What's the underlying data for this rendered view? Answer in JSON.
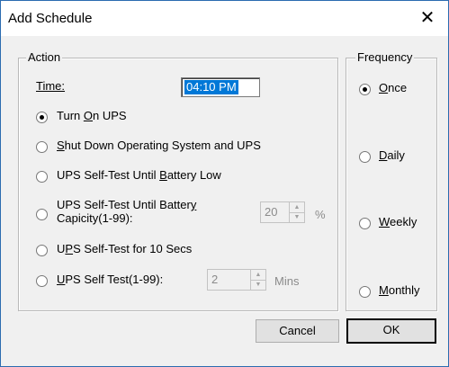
{
  "window": {
    "title": "Add Schedule",
    "close_glyph": "✕"
  },
  "action": {
    "legend": "Action",
    "time_label": "Time:",
    "time_value": "04:10 PM",
    "options": [
      {
        "pre": "Turn ",
        "mn": "O",
        "post": "n UPS",
        "checked": true
      },
      {
        "pre": "",
        "mn": "S",
        "post": "hut Down Operating System and UPS",
        "checked": false
      },
      {
        "pre": "UPS Self-Test Until ",
        "mn": "B",
        "post": "attery Low",
        "checked": false
      },
      {
        "line1_pre": "UPS Self-Test Until Batter",
        "line1_mn": "y",
        "line2": "Capicity(1-99):",
        "checked": false
      },
      {
        "pre": "U",
        "mn": "P",
        "post": "S Self-Test for 10 Secs",
        "checked": false
      },
      {
        "pre": "",
        "mn": "U",
        "post": "PS Self Test(1-99):",
        "checked": false
      }
    ],
    "capacity": {
      "value": "20",
      "unit": "%"
    },
    "self_test": {
      "value": "2",
      "unit": "Mins"
    }
  },
  "frequency": {
    "legend": "Frequency",
    "options": [
      {
        "pre": "",
        "mn": "O",
        "post": "nce",
        "checked": true
      },
      {
        "pre": "",
        "mn": "D",
        "post": "aily",
        "checked": false
      },
      {
        "pre": "",
        "mn": "W",
        "post": "eekly",
        "checked": false
      },
      {
        "pre": "",
        "mn": "M",
        "post": "onthly",
        "checked": false
      }
    ]
  },
  "buttons": {
    "cancel": "Cancel",
    "ok": "OK"
  }
}
